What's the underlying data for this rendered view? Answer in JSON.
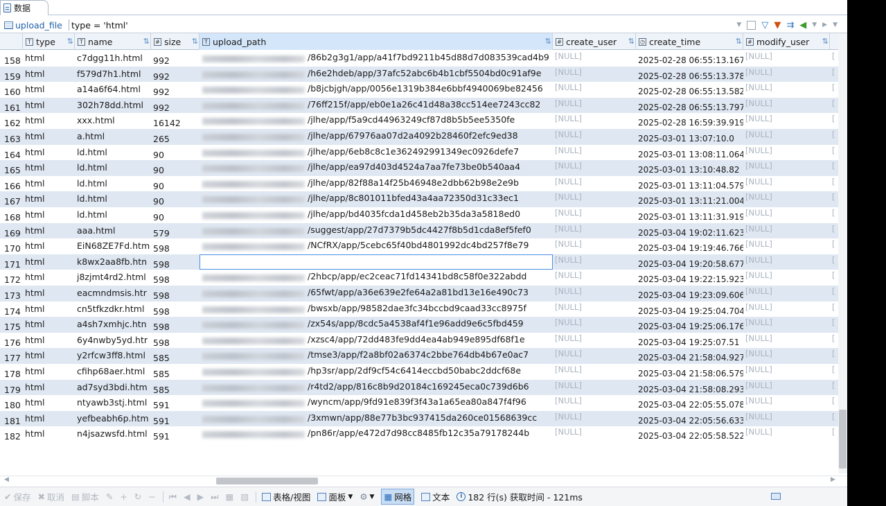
{
  "tab": {
    "label": "数据"
  },
  "filter": {
    "table_name": "upload_file",
    "expression": "type = 'html'"
  },
  "columns": [
    {
      "label": "type",
      "type_icon": "text-column-icon"
    },
    {
      "label": "name",
      "type_icon": "text-column-icon"
    },
    {
      "label": "size",
      "type_icon": "numeric-column-icon"
    },
    {
      "label": "upload_path",
      "type_icon": "text-column-icon"
    },
    {
      "label": "create_user",
      "type_icon": "numeric-column-icon"
    },
    {
      "label": "create_time",
      "type_icon": "datetime-column-icon"
    },
    {
      "label": "modify_user",
      "type_icon": "numeric-column-icon"
    }
  ],
  "rows": [
    {
      "num": "158",
      "type": "html",
      "name": "c7dgg11h.html",
      "size": "992",
      "path": "/86b2g3g1/app/a41f7bd9211b45d88d7d083539cad4b9",
      "create_user": "[NULL]",
      "create_time": "2025-02-28 06:55:13.167",
      "modify_user": "[NULL]",
      "extra": "["
    },
    {
      "num": "159",
      "type": "html",
      "name": "f579d7h1.html",
      "size": "992",
      "path": "/h6e2hdeb/app/37afc52abc6b4b1cbf5504bd0c91af9e",
      "create_user": "[NULL]",
      "create_time": "2025-02-28 06:55:13.378",
      "modify_user": "[NULL]",
      "extra": "["
    },
    {
      "num": "160",
      "type": "html",
      "name": "a14a6f64.html",
      "size": "992",
      "path": "/b8jcbjgh/app/0056e1319b384e6bbf4940069be82456",
      "create_user": "[NULL]",
      "create_time": "2025-02-28 06:55:13.582",
      "modify_user": "[NULL]",
      "extra": "["
    },
    {
      "num": "161",
      "type": "html",
      "name": "302h78dd.html",
      "size": "992",
      "path": "/76ff215f/app/eb0e1a26c41d48a38cc514ee7243cc82",
      "create_user": "[NULL]",
      "create_time": "2025-02-28 06:55:13.797",
      "modify_user": "[NULL]",
      "extra": "["
    },
    {
      "num": "162",
      "type": "html",
      "name": "xxx.html",
      "size": "16142",
      "path": "/jlhe/app/f5a9cd44963249cf87d8b5b5ee5350fe",
      "create_user": "[NULL]",
      "create_time": "2025-02-28 16:59:39.919",
      "modify_user": "[NULL]",
      "extra": "["
    },
    {
      "num": "163",
      "type": "html",
      "name": "a.html",
      "size": "265",
      "path": "/jlhe/app/67976aa07d2a4092b28460f2efc9ed38",
      "create_user": "[NULL]",
      "create_time": "2025-03-01 13:07:10.0",
      "modify_user": "[NULL]",
      "extra": "["
    },
    {
      "num": "164",
      "type": "html",
      "name": "ld.html",
      "size": "90",
      "path": "/jlhe/app/6eb8c8c1e362492991349ec0926defe7",
      "create_user": "[NULL]",
      "create_time": "2025-03-01 13:08:11.064",
      "modify_user": "[NULL]",
      "extra": "["
    },
    {
      "num": "165",
      "type": "html",
      "name": "ld.html",
      "size": "90",
      "path": "/jlhe/app/ea97d403d4524a7aa7fe73be0b540aa4",
      "create_user": "[NULL]",
      "create_time": "2025-03-01 13:10:48.82",
      "modify_user": "[NULL]",
      "extra": "["
    },
    {
      "num": "166",
      "type": "html",
      "name": "ld.html",
      "size": "90",
      "path": "/jlhe/app/82f88a14f25b46948e2dbb62b98e2e9b",
      "create_user": "[NULL]",
      "create_time": "2025-03-01 13:11:04.579",
      "modify_user": "[NULL]",
      "extra": "["
    },
    {
      "num": "167",
      "type": "html",
      "name": "ld.html",
      "size": "90",
      "path": "/jlhe/app/8c801011bfed43a4aa72350d31c33ec1",
      "create_user": "[NULL]",
      "create_time": "2025-03-01 13:11:21.004",
      "modify_user": "[NULL]",
      "extra": "["
    },
    {
      "num": "168",
      "type": "html",
      "name": "ld.html",
      "size": "90",
      "path": "/jlhe/app/bd4035fcda1d458eb2b35da3a5818ed0",
      "create_user": "[NULL]",
      "create_time": "2025-03-01 13:11:31.919",
      "modify_user": "[NULL]",
      "extra": "["
    },
    {
      "num": "169",
      "type": "html",
      "name": "aaa.html",
      "size": "579",
      "path": "/suggest/app/27d7379b5dc4427f8b5d1cda8ef5fef0",
      "create_user": "[NULL]",
      "create_time": "2025-03-04 19:02:11.623",
      "modify_user": "[NULL]",
      "extra": "["
    },
    {
      "num": "170",
      "type": "html",
      "name": "EiN68ZE7Fd.htm",
      "size": "598",
      "path": "/NCfRX/app/5cebc65f40bd4801992dc4bd257f8e79",
      "create_user": "[NULL]",
      "create_time": "2025-03-04 19:19:46.766",
      "modify_user": "[NULL]",
      "extra": "["
    },
    {
      "num": "171",
      "type": "html",
      "name": "k8wx2aa8fb.htn",
      "size": "598",
      "path": "",
      "create_user": "[NULL]",
      "create_time": "2025-03-04 19:20:58.677",
      "modify_user": "[NULL]",
      "extra": "["
    },
    {
      "num": "172",
      "type": "html",
      "name": "j8zjmt4rd2.html",
      "size": "598",
      "path": "/2hbcp/app/ec2ceac71fd14341bd8c58f0e322abdd",
      "create_user": "[NULL]",
      "create_time": "2025-03-04 19:22:15.923",
      "modify_user": "[NULL]",
      "extra": "["
    },
    {
      "num": "173",
      "type": "html",
      "name": "eacmndmsis.htr",
      "size": "598",
      "path": "/65fwt/app/a36e639e2fe64a2a81bd13e16e490c73",
      "create_user": "[NULL]",
      "create_time": "2025-03-04 19:23:09.606",
      "modify_user": "[NULL]",
      "extra": "["
    },
    {
      "num": "174",
      "type": "html",
      "name": "cn5tfkzdkr.html",
      "size": "598",
      "path": "/bwsxb/app/98582dae3fc34bccbd9caad33cc8975f",
      "create_user": "[NULL]",
      "create_time": "2025-03-04 19:25:04.704",
      "modify_user": "[NULL]",
      "extra": "["
    },
    {
      "num": "175",
      "type": "html",
      "name": "a4sh7xmhjc.htn",
      "size": "598",
      "path": "/zx54s/app/8cdc5a4538af4f1e96add9e6c5fbd459",
      "create_user": "[NULL]",
      "create_time": "2025-03-04 19:25:06.176",
      "modify_user": "[NULL]",
      "extra": "["
    },
    {
      "num": "176",
      "type": "html",
      "name": "6y4nwby5yd.htr",
      "size": "598",
      "path": "/xzsc4/app/72dd483fe9dd4ea4ab949e895df68f1e",
      "create_user": "[NULL]",
      "create_time": "2025-03-04 19:25:07.51",
      "modify_user": "[NULL]",
      "extra": "["
    },
    {
      "num": "177",
      "type": "html",
      "name": "y2rfcw3ff8.html",
      "size": "585",
      "path": "/tmse3/app/f2a8bf02a6374c2bbe764db4b67e0ac7",
      "create_user": "[NULL]",
      "create_time": "2025-03-04 21:58:04.927",
      "modify_user": "[NULL]",
      "extra": "["
    },
    {
      "num": "178",
      "type": "html",
      "name": "cfihp68aer.html",
      "size": "585",
      "path": "/hp3sr/app/2df9cf54c6414eccbd50babc2ddcf68e",
      "create_user": "[NULL]",
      "create_time": "2025-03-04 21:58:06.579",
      "modify_user": "[NULL]",
      "extra": "["
    },
    {
      "num": "179",
      "type": "html",
      "name": "ad7syd3bdi.htm",
      "size": "585",
      "path": "/r4td2/app/816c8b9d20184c169245eca0c739d6b6",
      "create_user": "[NULL]",
      "create_time": "2025-03-04 21:58:08.293",
      "modify_user": "[NULL]",
      "extra": "["
    },
    {
      "num": "180",
      "type": "html",
      "name": "ntyawb3stj.html",
      "size": "591",
      "path": "/wyncm/app/9fd91e839f3f43a1a65ea80a847f4f96",
      "create_user": "[NULL]",
      "create_time": "2025-03-04 22:05:55.078",
      "modify_user": "[NULL]",
      "extra": "["
    },
    {
      "num": "181",
      "type": "html",
      "name": "yefbeabh6p.htm",
      "size": "591",
      "path": "/3xmwn/app/88e77b3bc937415da260ce01568639cc",
      "create_user": "[NULL]",
      "create_time": "2025-03-04 22:05:56.633",
      "modify_user": "[NULL]",
      "extra": "["
    },
    {
      "num": "182",
      "type": "html",
      "name": "n4jsazwsfd.html",
      "size": "591",
      "path": "/pn86r/app/e472d7d98cc8485fb12c35a79178244b",
      "create_user": "[NULL]",
      "create_time": "2025-03-04 22:05:58.522",
      "modify_user": "[NULL]",
      "extra": "["
    }
  ],
  "active_row_index": 13,
  "statusbar": {
    "save": "保存",
    "cancel": "取消",
    "script": "脚本",
    "table_view": "表格/视图",
    "panel": "面板",
    "grid": "网格",
    "text": "文本",
    "row_info": "182 行(s) 获取时间 - 121ms"
  }
}
